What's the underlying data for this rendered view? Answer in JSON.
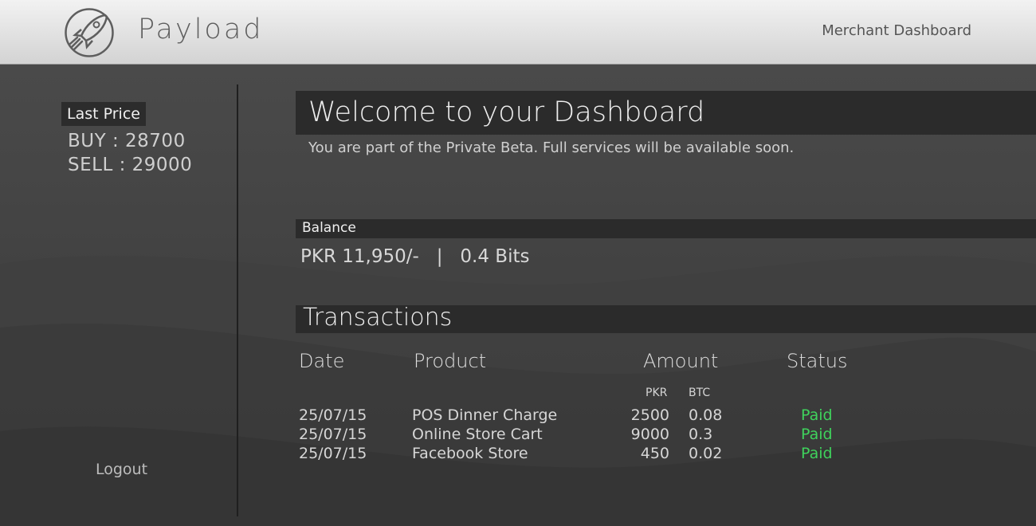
{
  "header": {
    "brand": "Payload",
    "right_link": "Merchant Dashboard",
    "logo_icon": "rocket-icon"
  },
  "sidebar": {
    "last_price_label": "Last Price",
    "buy": "BUY : 28700",
    "sell": "SELL : 29000",
    "logout": "Logout"
  },
  "main": {
    "welcome_title": "Welcome to your Dashboard",
    "welcome_subtitle": "You are part of the Private Beta. Full services will be available soon.",
    "balance_label": "Balance",
    "balance_pkr": "PKR 11,950/-",
    "balance_sep": "|",
    "balance_btc": "0.4 Bits",
    "transactions_title": "Transactions",
    "columns": {
      "date": "Date",
      "product": "Product",
      "amount": "Amount",
      "status": "Status",
      "pkr": "PKR",
      "btc": "BTC"
    },
    "rows": [
      {
        "date": "25/07/15",
        "product": "POS Dinner Charge",
        "pkr": "2500",
        "btc": "0.08",
        "status": "Paid"
      },
      {
        "date": "25/07/15",
        "product": "Online Store Cart",
        "pkr": "9000",
        "btc": "0.3",
        "status": "Paid"
      },
      {
        "date": "25/07/15",
        "product": "Facebook Store",
        "pkr": "450",
        "btc": "0.02",
        "status": "Paid"
      }
    ]
  },
  "colors": {
    "header_bg": "#e6e6e6",
    "page_bg": "#464646",
    "bar_bg": "#2b2b2b",
    "paid": "#3fd25c"
  }
}
